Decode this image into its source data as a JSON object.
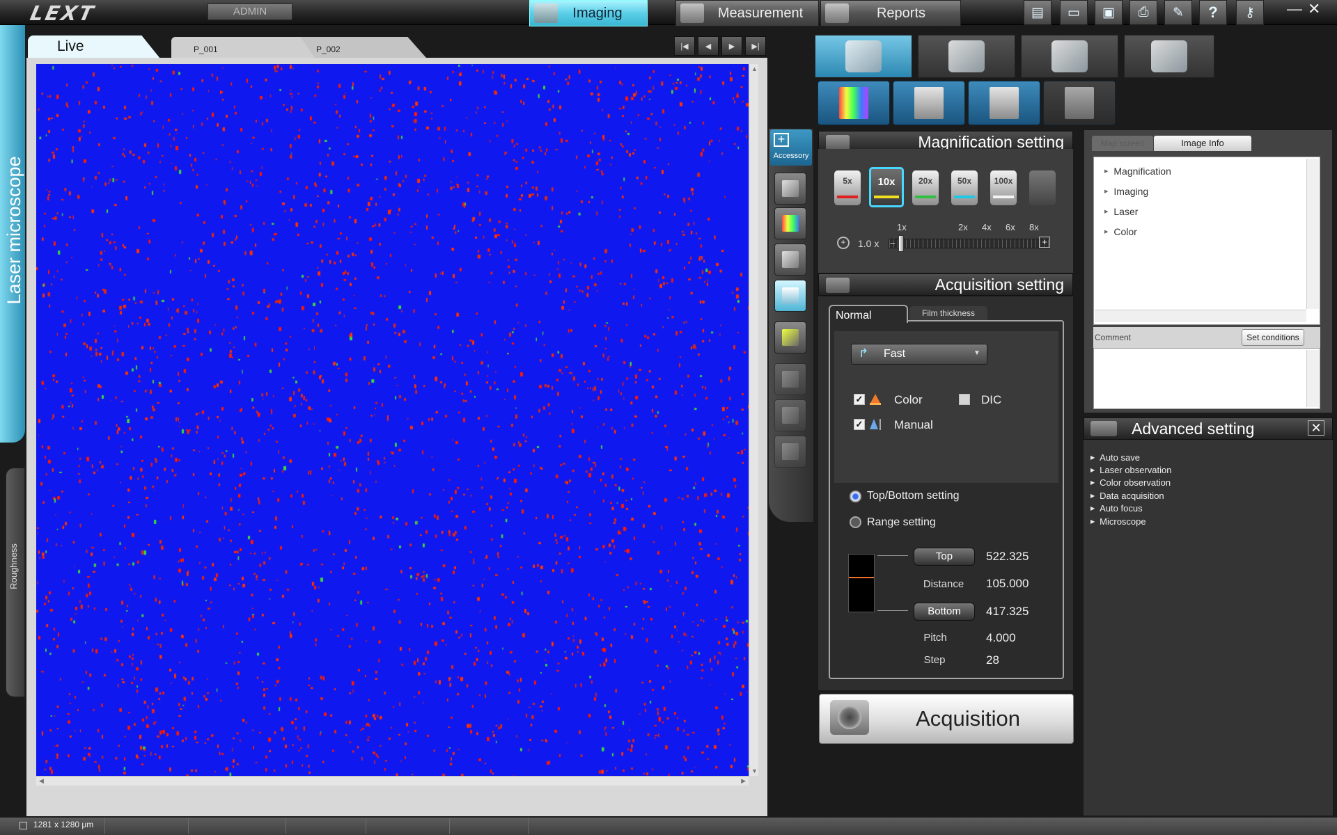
{
  "app": {
    "logo": "LEXT",
    "user": "ADMIN"
  },
  "mode_tabs": [
    {
      "label": "Imaging",
      "active": true
    },
    {
      "label": "Measurement",
      "active": false
    },
    {
      "label": "Reports",
      "active": false
    }
  ],
  "toolbar_icons": [
    "file-icon",
    "folder-open-icon",
    "save-icon",
    "print-icon",
    "wrench-icon",
    "help-icon",
    "key-icon"
  ],
  "help_glyph": "?",
  "window": {
    "minimize": "—",
    "close": "✕"
  },
  "left_tabs": {
    "main": "Laser microscope",
    "secondary": "Roughness"
  },
  "image_tabs": [
    {
      "label": "Live",
      "active": true
    },
    {
      "label": "P_001",
      "active": false
    },
    {
      "label": "P_002",
      "active": false
    }
  ],
  "nav_buttons": {
    "first": "|◀",
    "prev": "◀",
    "next": "▶",
    "last": "▶|"
  },
  "image": {
    "background": "#1018f0",
    "speckle_colors": [
      "#ff1a00",
      "#e02a10",
      "#ff3300",
      "#3fd83a"
    ]
  },
  "side_toolbar": {
    "accessory_label": "Accessory",
    "accessory_plus": "+"
  },
  "magnification": {
    "title": "Magnification setting",
    "objectives": [
      {
        "label": "5x",
        "band": "#e02020",
        "active": false
      },
      {
        "label": "10x",
        "band": "#f0e020",
        "active": true
      },
      {
        "label": "20x",
        "band": "#30c040",
        "active": false
      },
      {
        "label": "50x",
        "band": "#20c8e8",
        "active": false
      },
      {
        "label": "100x",
        "band": "#f4f4f4",
        "active": false
      },
      {
        "label": "",
        "band": "",
        "active": false
      }
    ],
    "zoom_marks": [
      "1x",
      "2x",
      "4x",
      "6x",
      "8x"
    ],
    "zoom_value": "1.0",
    "zoom_unit": "x"
  },
  "acquisition": {
    "title": "Acquisition setting",
    "tabs": {
      "normal": "Normal",
      "film": "Film thickness"
    },
    "mode": "Fast",
    "checks": {
      "color": {
        "label": "Color",
        "checked": true
      },
      "dic": {
        "label": "DIC",
        "checked": false
      },
      "manual": {
        "label": "Manual",
        "checked": true
      }
    },
    "check_glyph": "✓",
    "radios": {
      "top_bottom": {
        "label": "Top/Bottom setting",
        "selected": true
      },
      "range": {
        "label": "Range setting",
        "selected": false
      }
    },
    "top_button": "Top",
    "top_value": "522.325",
    "distance_label": "Distance",
    "distance_value": "105.000",
    "bottom_button": "Bottom",
    "bottom_value": "417.325",
    "pitch_label": "Pitch",
    "pitch_value": "4.000",
    "step_label": "Step",
    "step_value": "28",
    "acquire_button": "Acquisition"
  },
  "info_panel": {
    "tabs": {
      "map_screen": "Map screen",
      "image_info": "Image Info"
    },
    "tree": [
      "Magnification",
      "Imaging",
      "Laser",
      "Color"
    ],
    "comment_label": "Comment",
    "set_conditions": "Set conditions"
  },
  "advanced": {
    "title": "Advanced setting",
    "close": "✕",
    "items": [
      "Auto save",
      "Laser observation",
      "Color observation",
      "Data acquisition",
      "Auto focus",
      "Microscope"
    ]
  },
  "status": {
    "size": "1281 x 1280 μm"
  }
}
